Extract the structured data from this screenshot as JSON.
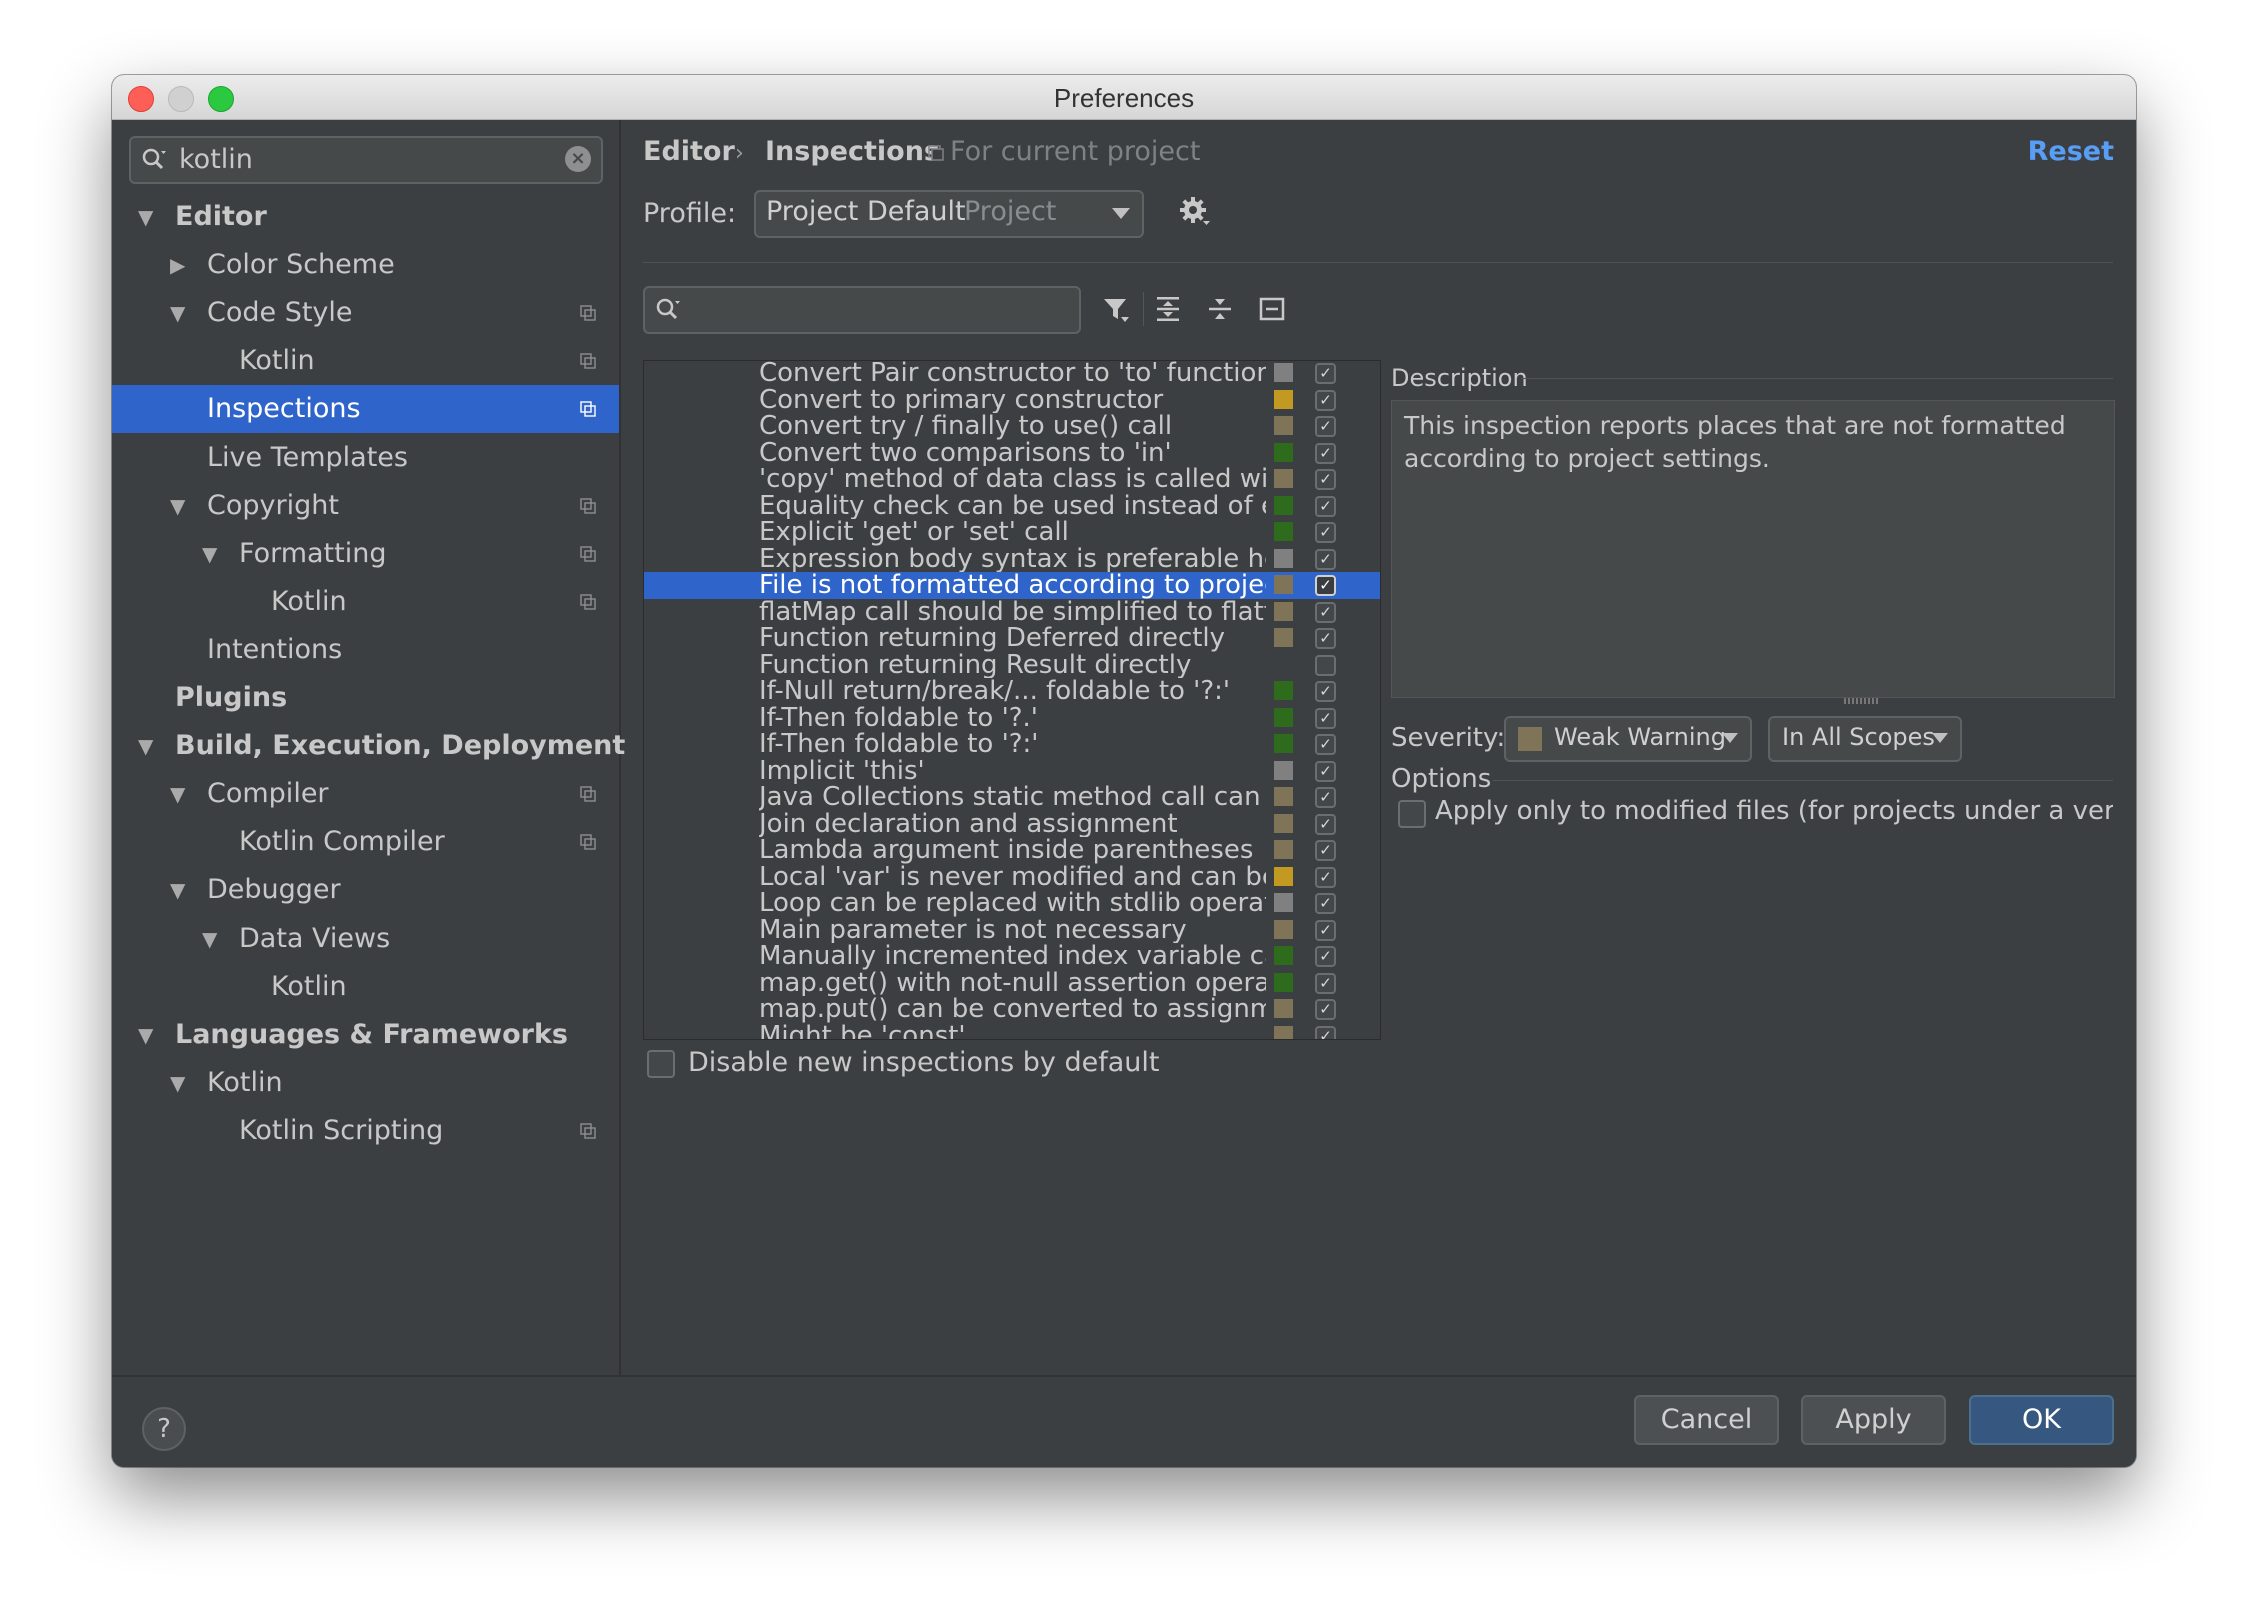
{
  "window": {
    "title": "Preferences"
  },
  "sidebar": {
    "search_value": "kotlin",
    "items": [
      {
        "label": "Editor",
        "level": 0,
        "bold": true,
        "arrow": "down",
        "copy": false,
        "selected": false
      },
      {
        "label": "Color Scheme",
        "level": 1,
        "bold": false,
        "arrow": "right",
        "copy": false,
        "selected": false
      },
      {
        "label": "Code Style",
        "level": 1,
        "bold": false,
        "arrow": "down",
        "copy": true,
        "selected": false
      },
      {
        "label": "Kotlin",
        "level": 2,
        "bold": false,
        "arrow": "",
        "copy": true,
        "selected": false
      },
      {
        "label": "Inspections",
        "level": 1,
        "bold": false,
        "arrow": "",
        "copy": true,
        "selected": true
      },
      {
        "label": "Live Templates",
        "level": 1,
        "bold": false,
        "arrow": "",
        "copy": false,
        "selected": false
      },
      {
        "label": "Copyright",
        "level": 1,
        "bold": false,
        "arrow": "down",
        "copy": true,
        "selected": false
      },
      {
        "label": "Formatting",
        "level": 2,
        "bold": false,
        "arrow": "down",
        "copy": true,
        "selected": false
      },
      {
        "label": "Kotlin",
        "level": 3,
        "bold": false,
        "arrow": "",
        "copy": true,
        "selected": false
      },
      {
        "label": "Intentions",
        "level": 1,
        "bold": false,
        "arrow": "",
        "copy": false,
        "selected": false
      },
      {
        "label": "Plugins",
        "level": 0,
        "bold": true,
        "arrow": "",
        "copy": false,
        "selected": false
      },
      {
        "label": "Build, Execution, Deployment",
        "level": 0,
        "bold": true,
        "arrow": "down",
        "copy": false,
        "selected": false
      },
      {
        "label": "Compiler",
        "level": 1,
        "bold": false,
        "arrow": "down",
        "copy": true,
        "selected": false
      },
      {
        "label": "Kotlin Compiler",
        "level": 2,
        "bold": false,
        "arrow": "",
        "copy": true,
        "selected": false
      },
      {
        "label": "Debugger",
        "level": 1,
        "bold": false,
        "arrow": "down",
        "copy": false,
        "selected": false
      },
      {
        "label": "Data Views",
        "level": 2,
        "bold": false,
        "arrow": "down",
        "copy": false,
        "selected": false
      },
      {
        "label": "Kotlin",
        "level": 3,
        "bold": false,
        "arrow": "",
        "copy": false,
        "selected": false
      },
      {
        "label": "Languages & Frameworks",
        "level": 0,
        "bold": true,
        "arrow": "down",
        "copy": false,
        "selected": false
      },
      {
        "label": "Kotlin",
        "level": 1,
        "bold": false,
        "arrow": "down",
        "copy": false,
        "selected": false
      },
      {
        "label": "Kotlin Scripting",
        "level": 2,
        "bold": false,
        "arrow": "",
        "copy": true,
        "selected": false
      }
    ]
  },
  "header": {
    "crumb_editor": "Editor",
    "crumb_sep": "›",
    "crumb_inspections": "Inspections",
    "for_current_project": "For current project",
    "reset": "Reset"
  },
  "profile": {
    "label": "Profile:",
    "value": "Project Default",
    "scope": "Project"
  },
  "severity_colors": {
    "weak_warning": "#7f7457",
    "warning": "#c29a21",
    "typo": "#808080",
    "info": "#2e6b1c"
  },
  "inspections": [
    {
      "name": "Convert Pair constructor to 'to' function",
      "color": "#808080",
      "checked": true
    },
    {
      "name": "Convert to primary constructor",
      "color": "#c29a21",
      "checked": true
    },
    {
      "name": "Convert try / finally to use() call",
      "color": "#7f7457",
      "checked": true
    },
    {
      "name": "Convert two comparisons to 'in'",
      "color": "#2e6b1c",
      "checked": true
    },
    {
      "name": "'copy' method of data class is called with",
      "color": "#7f7457",
      "checked": true
    },
    {
      "name": "Equality check can be used instead of elv",
      "color": "#2e6b1c",
      "checked": true
    },
    {
      "name": "Explicit 'get' or 'set' call",
      "color": "#2e6b1c",
      "checked": true
    },
    {
      "name": "Expression body syntax is preferable her",
      "color": "#808080",
      "checked": true
    },
    {
      "name": "File is not formatted according to project",
      "color": "#7f7457",
      "checked": true,
      "selected": true
    },
    {
      "name": "flatMap call should be simplified to flatte",
      "color": "#7f7457",
      "checked": true
    },
    {
      "name": "Function returning Deferred directly",
      "color": "#7f7457",
      "checked": true
    },
    {
      "name": "Function returning Result directly",
      "color": "",
      "checked": false
    },
    {
      "name": "If-Null return/break/... foldable to '?:'",
      "color": "#2e6b1c",
      "checked": true
    },
    {
      "name": "If-Then foldable to '?.'",
      "color": "#2e6b1c",
      "checked": true
    },
    {
      "name": "If-Then foldable to '?:'",
      "color": "#2e6b1c",
      "checked": true
    },
    {
      "name": "Implicit 'this'",
      "color": "#808080",
      "checked": true
    },
    {
      "name": "Java Collections static method call can be",
      "color": "#7f7457",
      "checked": true
    },
    {
      "name": "Join declaration and assignment",
      "color": "#7f7457",
      "checked": true
    },
    {
      "name": "Lambda argument inside parentheses",
      "color": "#7f7457",
      "checked": true
    },
    {
      "name": "Local 'var' is never modified and can be d",
      "color": "#c29a21",
      "checked": true
    },
    {
      "name": "Loop can be replaced with stdlib operatic",
      "color": "#808080",
      "checked": true
    },
    {
      "name": "Main parameter is not necessary",
      "color": "#7f7457",
      "checked": true
    },
    {
      "name": "Manually incremented index variable can",
      "color": "#2e6b1c",
      "checked": true
    },
    {
      "name": "map.get() with not-null assertion operatc",
      "color": "#2e6b1c",
      "checked": true
    },
    {
      "name": "map.put() can be converted to assignme",
      "color": "#7f7457",
      "checked": true
    },
    {
      "name": "Might be 'const'",
      "color": "#7f7457",
      "checked": true
    }
  ],
  "disable_new": "Disable new inspections by default",
  "description": {
    "label": "Description",
    "text": "This inspection reports places that are not formatted according to project settings."
  },
  "severity": {
    "label": "Severity:",
    "value": "Weak Warning",
    "scope": "In All Scopes"
  },
  "options": {
    "label": "Options",
    "apply_modified": "Apply only to modified files (for projects under a version"
  },
  "buttons": {
    "help": "?",
    "cancel": "Cancel",
    "apply": "Apply",
    "ok": "OK"
  },
  "icons": {
    "search": "search-icon",
    "clear": "clear-icon",
    "copy": "copy-icon",
    "gear": "gear-icon",
    "filter": "filter-icon",
    "expand": "expand-all-icon",
    "collapse": "collapse-all-icon",
    "reset": "reset-icon"
  }
}
